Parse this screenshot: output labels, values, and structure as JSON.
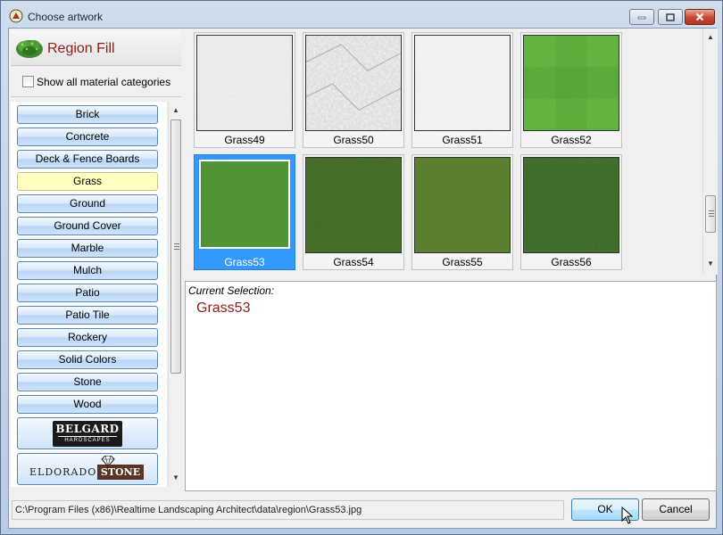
{
  "window": {
    "title": "Choose artwork"
  },
  "left_panel": {
    "header_title": "Region Fill",
    "show_all_label": "Show all material categories",
    "show_all_checked": false,
    "categories": [
      {
        "label": "Brick",
        "selected": false
      },
      {
        "label": "Concrete",
        "selected": false
      },
      {
        "label": "Deck & Fence Boards",
        "selected": false
      },
      {
        "label": "Grass",
        "selected": true
      },
      {
        "label": "Ground",
        "selected": false
      },
      {
        "label": "Ground Cover",
        "selected": false
      },
      {
        "label": "Marble",
        "selected": false
      },
      {
        "label": "Mulch",
        "selected": false
      },
      {
        "label": "Patio",
        "selected": false
      },
      {
        "label": "Patio Tile",
        "selected": false
      },
      {
        "label": "Rockery",
        "selected": false
      },
      {
        "label": "Solid Colors",
        "selected": false
      },
      {
        "label": "Stone",
        "selected": false
      },
      {
        "label": "Wood",
        "selected": false
      }
    ],
    "brand_buttons": [
      {
        "name": "BELGARD",
        "sub": "HARDSCAPES"
      },
      {
        "name": "ELDORADO",
        "name2": "STONE"
      }
    ]
  },
  "thumbnails": [
    {
      "label": "Grass49",
      "style": "light-gray-pebble",
      "selected": false
    },
    {
      "label": "Grass50",
      "style": "light-gray-stone",
      "selected": false
    },
    {
      "label": "Grass51",
      "style": "light-gray-speckle",
      "selected": false
    },
    {
      "label": "Grass52",
      "style": "bright-green-mowed",
      "selected": false
    },
    {
      "label": "Grass53",
      "style": "green-lawn",
      "selected": true
    },
    {
      "label": "Grass54",
      "style": "dark-green-lawn",
      "selected": false
    },
    {
      "label": "Grass55",
      "style": "olive-green-lawn",
      "selected": false
    },
    {
      "label": "Grass56",
      "style": "deep-green-lawn",
      "selected": false
    }
  ],
  "selection": {
    "caption": "Current Selection:",
    "value": "Grass53"
  },
  "footer": {
    "path": "C:\\Program Files (x86)\\Realtime Landscaping Architect\\data\\region\\Grass53.jpg",
    "ok_label": "OK",
    "cancel_label": "Cancel"
  },
  "colors": {
    "accent_red": "#8a1c1c",
    "selection_blue": "#3399ff",
    "selected_category": "#ffffc0"
  }
}
